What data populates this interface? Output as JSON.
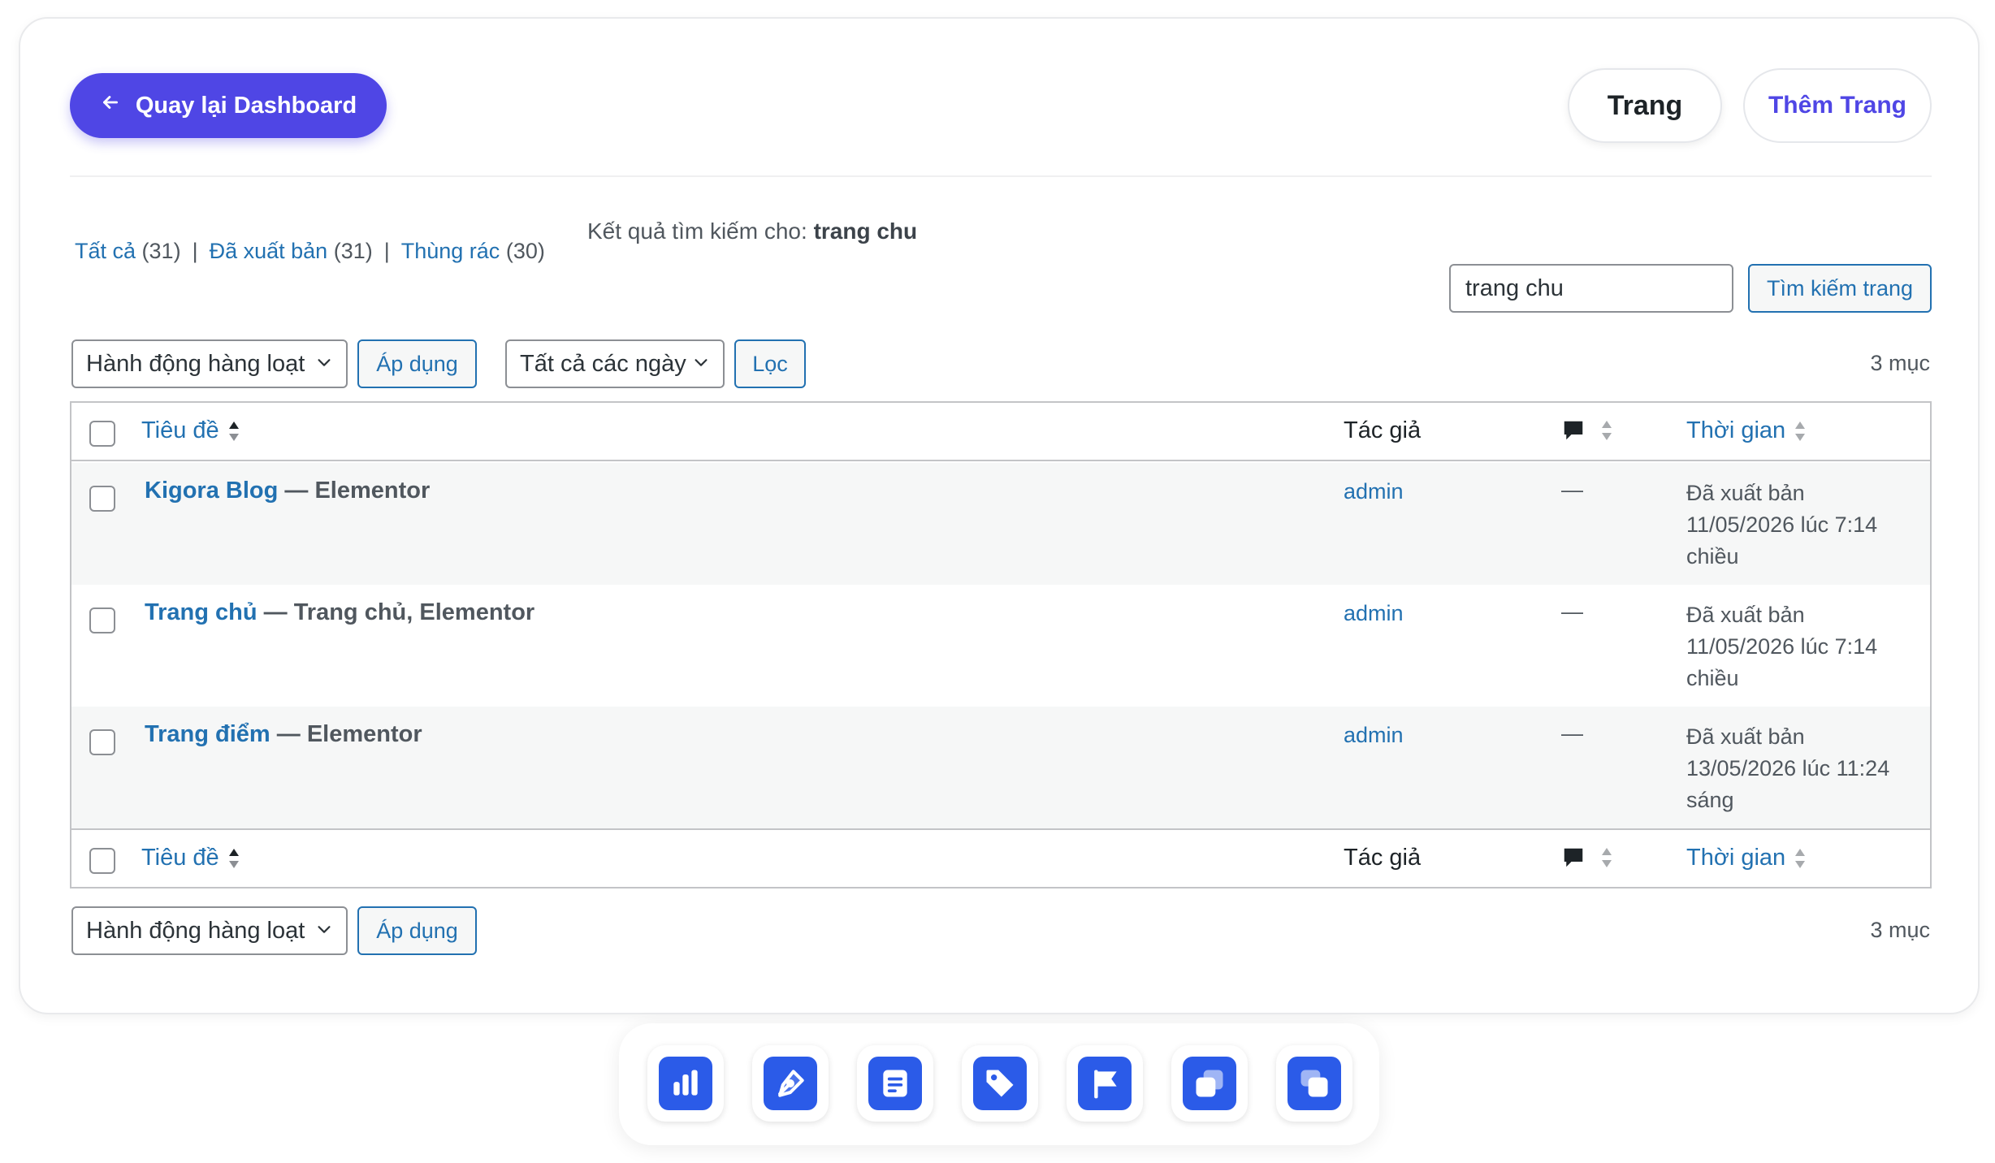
{
  "header": {
    "back_label": "Quay lại Dashboard",
    "pages_label": "Trang",
    "add_page_label": "Thêm Trang"
  },
  "views": {
    "all_label": "Tất cả",
    "all_count": "(31)",
    "published_label": "Đã xuất bản",
    "published_count": "(31)",
    "trash_label": "Thùng rác",
    "trash_count": "(30)",
    "separator": "|"
  },
  "search": {
    "result_prefix": "Kết quả tìm kiếm cho:",
    "query": "trang chu",
    "input_value": "trang chu",
    "button_label": "Tìm kiếm trang"
  },
  "toolbar": {
    "bulk_action": "Hành động hàng loạt",
    "apply_label": "Áp dụng",
    "dates_filter": "Tất cả các ngày",
    "filter_label": "Lọc",
    "item_count": "3 mục"
  },
  "table": {
    "headers": {
      "title": "Tiêu đề",
      "author": "Tác giả",
      "date": "Thời gian"
    },
    "rows": [
      {
        "title": "Kigora Blog",
        "states": " — Elementor",
        "author": "admin",
        "comments": "—",
        "status": "Đã xuất bản",
        "date": "11/05/2026 lúc 7:14 chiều"
      },
      {
        "title": "Trang chủ",
        "states": " — Trang chủ, Elementor",
        "author": "admin",
        "comments": "—",
        "status": "Đã xuất bản",
        "date": "11/05/2026 lúc 7:14 chiều"
      },
      {
        "title": "Trang điểm",
        "states": " — Elementor",
        "author": "admin",
        "comments": "—",
        "status": "Đã xuất bản",
        "date": "13/05/2026 lúc 11:24 sáng"
      }
    ]
  },
  "dock": {
    "items": [
      "chart-icon",
      "pen-icon",
      "document-icon",
      "tag-icon",
      "flag-icon",
      "copy-icon",
      "chat-icon"
    ]
  },
  "colors": {
    "accent": "#4f46e5",
    "link": "#2271b1",
    "dock_tile": "#2b5be8"
  }
}
